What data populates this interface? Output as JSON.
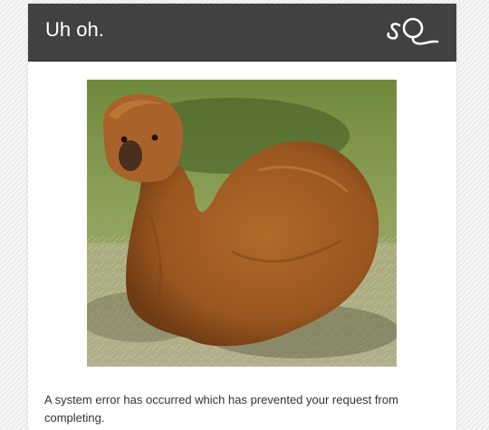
{
  "header": {
    "title": "Uh oh.",
    "logo_icon": "sq-logo-icon",
    "background_color": "#414141"
  },
  "image": {
    "subject": "alpaca-photo",
    "alt": ""
  },
  "error": {
    "message": "A system error has occurred which has prevented your request from completing."
  },
  "colors": {
    "page_background": "#f1f1f1",
    "card_background": "#ffffff",
    "header_text": "#ffffff",
    "body_text": "#333333"
  }
}
